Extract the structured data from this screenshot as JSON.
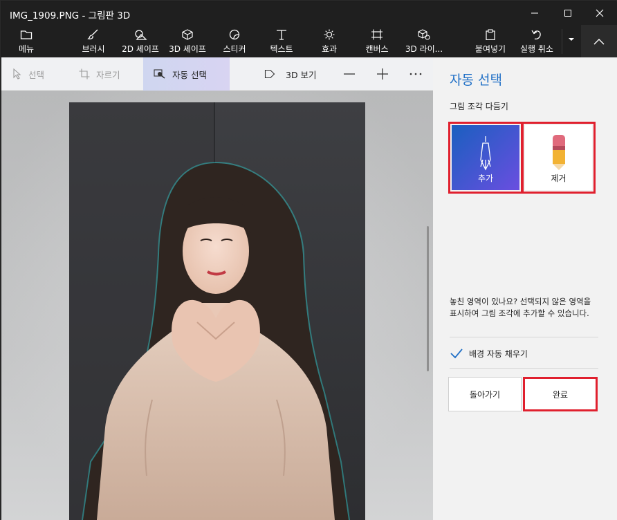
{
  "window": {
    "title": "IMG_1909.PNG - 그림판 3D"
  },
  "ribbon": {
    "menu": "메뉴",
    "brush": "브러시",
    "shapes_2d": "2D 셰이프",
    "shapes_3d": "3D 셰이프",
    "stickers": "스티커",
    "text": "텍스트",
    "effects": "효과",
    "canvas": "캔버스",
    "library_3d": "3D 라이...",
    "paste": "붙여넣기",
    "undo": "실행 취소"
  },
  "toolbar": {
    "select": "선택",
    "crop": "자르기",
    "magic_select": "자동 선택",
    "view_3d": "3D 보기"
  },
  "panel": {
    "title": "자동 선택",
    "subtitle": "그림 조각 다듬기",
    "add_label": "추가",
    "remove_label": "제거",
    "help_text": "놓친 영역이 있나요? 선택되지 않은 영역을 표시하여 그림 조각에 추가할 수 있습니다.",
    "autofill_label": "배경 자동 채우기",
    "autofill_checked": true,
    "back_label": "돌아가기",
    "done_label": "완료"
  },
  "colors": {
    "accent": "#1f6fc6",
    "highlight_border": "#e0202e",
    "add_gradient_start": "#1a5fbf",
    "add_gradient_end": "#6a4ee0",
    "titlebar": "#1f1f1f"
  }
}
